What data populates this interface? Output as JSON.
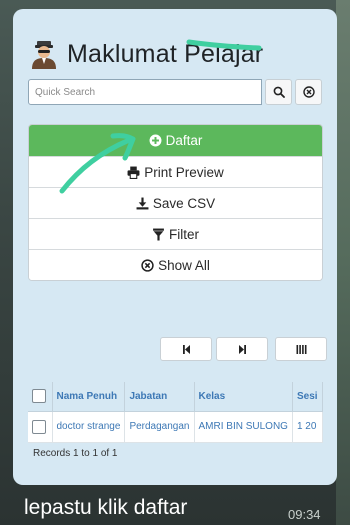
{
  "header": {
    "title": "Maklumat Pelajar",
    "title_icon": "student-avatar-icon"
  },
  "search": {
    "placeholder": "Quick Search",
    "search_icon": "search-icon",
    "clear_icon": "clear-circle-icon"
  },
  "menu": {
    "items": [
      {
        "label": "Daftar",
        "icon": "plus-circle-icon"
      },
      {
        "label": "Print Preview",
        "icon": "printer-icon"
      },
      {
        "label": "Save CSV",
        "icon": "download-icon"
      },
      {
        "label": "Filter",
        "icon": "filter-icon"
      },
      {
        "label": "Show All",
        "icon": "close-circle-icon"
      }
    ]
  },
  "pager": {
    "icons": [
      "first-page-icon",
      "last-page-icon",
      "columns-icon"
    ]
  },
  "table": {
    "columns": [
      "Nama Penuh",
      "Jabatan",
      "Kelas",
      "Sesi"
    ],
    "rows": [
      [
        "doctor strange",
        "Perdagangan",
        "AMRI BIN SULONG",
        "1 20"
      ]
    ],
    "records_text": "Records 1 to 1 of 1"
  },
  "chat": {
    "caption": "lepastu klik daftar",
    "time": "09:34"
  },
  "colors": {
    "card_bg": "#d6e8f3",
    "primary_button": "#5cb85c",
    "link_text": "#3d78b5",
    "annotation": "#3fcfa0"
  }
}
